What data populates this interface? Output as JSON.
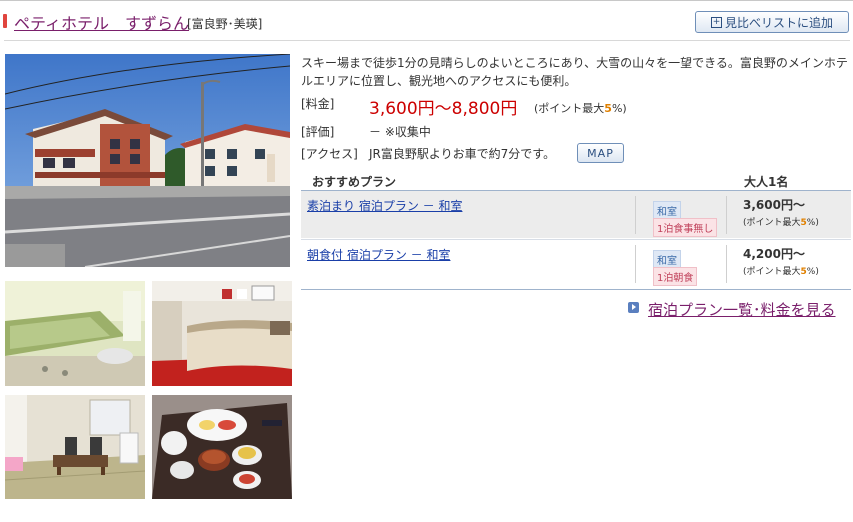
{
  "header": {
    "hotel_name": "ペティホテル　すずらん",
    "area": "[富良野･美瑛]",
    "compare_button": "見比べリストに追加",
    "compare_icon": "plus-square-icon"
  },
  "photos": [
    {
      "name": "hotel-exterior-photo"
    },
    {
      "name": "bath-photo"
    },
    {
      "name": "lobby-photo"
    },
    {
      "name": "japanese-room-photo"
    },
    {
      "name": "meal-photo"
    }
  ],
  "description": "スキー場まで徒歩1分の見晴らしのよいところにあり、大雪の山々を一望できる。富良野のメインホテルエリアに位置し、観光地へのアクセスにも便利。",
  "info": {
    "price_label": "[料金]",
    "price_value": "3,600円～8,800円",
    "price_points_prefix": "(ポイント最大",
    "price_points_num": "5",
    "price_points_suffix": "%)",
    "rating_label": "[評価]",
    "rating_value": "－ ※収集中",
    "access_label": "[アクセス]",
    "access_value": "JR富良野駅よりお車で約7分です。",
    "map_button": "MAP"
  },
  "plans": {
    "header_plan": "おすすめプラン",
    "header_price": "大人1名",
    "rows": [
      {
        "name": "素泊まり 宿泊プラン － 和室",
        "room_tag": "和室",
        "meal_tag": "1泊食事無し",
        "price": "3,600円～",
        "points_prefix": "(ポイント最大",
        "points_num": "5",
        "points_suffix": "%)"
      },
      {
        "name": "朝食付 宿泊プラン － 和室",
        "room_tag": "和室",
        "meal_tag": "1泊朝食",
        "price": "4,200円～",
        "points_prefix": "(ポイント最大",
        "points_num": "5",
        "points_suffix": "%)"
      }
    ]
  },
  "more_link": "宿泊プラン一覧･料金を見る",
  "more_icon": "arrow-right-icon",
  "colors": {
    "brand_purple": "#7a1f6b",
    "price_red": "#cc0000",
    "link_blue": "#1a3fa8",
    "accent_blue": "#5a7fbf"
  }
}
